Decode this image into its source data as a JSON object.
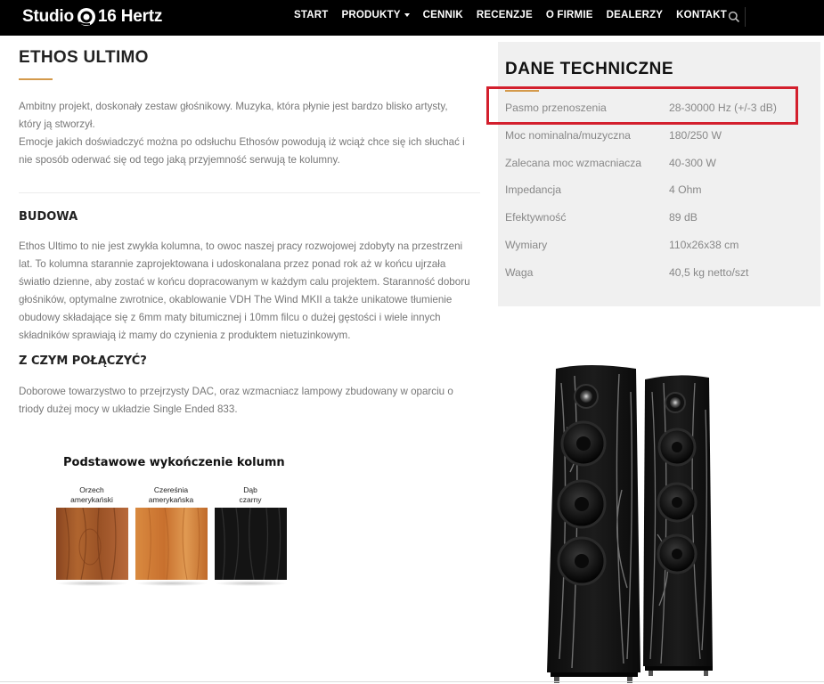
{
  "header": {
    "logo_left": "Studio",
    "logo_right": "16 Hertz",
    "nav": [
      {
        "label": "START"
      },
      {
        "label": "PRODUKTY",
        "has_dropdown": true
      },
      {
        "label": "CENNIK"
      },
      {
        "label": "RECENZJE"
      },
      {
        "label": "O FIRMIE"
      },
      {
        "label": "DEALERZY"
      },
      {
        "label": "KONTAKT"
      }
    ],
    "search_icon": "search-icon"
  },
  "main": {
    "title": "ETHOS ULTIMO",
    "intro": [
      "Ambitny projekt, doskonały zestaw głośnikowy. Muzyka, która płynie jest bardzo blisko artysty,",
      "który ją stworzył.",
      "Emocje jakich doświadczyć można po odsłuchu Ethosów powodują iż wciąż chce się ich słuchać i",
      "nie sposób oderwać się od tego jaką przyjemność serwują te kolumny."
    ],
    "budowa_heading": "BUDOWA",
    "budowa_text": [
      "Ethos Ultimo to nie jest zwykła kolumna, to owoc naszej pracy rozwojowej zdobyty na przestrzeni",
      "lat. To kolumna starannie zaprojektowana i udoskonalana  przez ponad rok aż w końcu ujrzała",
      "światło dzienne, aby zostać w końcu dopracowanym w każdym calu projektem. Staranność doboru",
      "głośników, optymalne zwrotnice, okablowanie VDH The Wind MKII a także unikatowe tłumienie",
      "obudowy składające się z 6mm maty bitumicznej i 10mm filcu o dużej gęstości i wiele innych",
      "składników sprawiają iż mamy do czynienia z produktem nietuzinkowym."
    ],
    "pair_heading": "Z CZYM POŁĄCZYĆ?",
    "pair_text": [
      "Doborowe towarzystwo to przejrzysty DAC, oraz wzmacniacz lampowy zbudowany w oparciu o",
      "triody dużej mocy w układzie Single Ended 833."
    ],
    "finish": {
      "title": "Podstawowe wykończenie kolumn",
      "options": [
        {
          "label_l1": "Orzech",
          "label_l2": "amerykański",
          "color": "#a0522d"
        },
        {
          "label_l1": "Czereśnia",
          "label_l2": "amerykańska",
          "color": "#c8702e"
        },
        {
          "label_l1": "Dąb",
          "label_l2": "czarny",
          "color": "#141414"
        }
      ]
    }
  },
  "tech": {
    "title": "DANE TECHNICZNE",
    "specs": [
      {
        "label": "Pasmo przenoszenia",
        "value": "28-30000 Hz (+/-3 dB)"
      },
      {
        "label": "Moc nominalna/muzyczna",
        "value": "180/250 W"
      },
      {
        "label": "Zalecana moc wzmacniacza",
        "value": "40-300 W"
      },
      {
        "label": "Impedancja",
        "value": "4 Ohm"
      },
      {
        "label": "Efektywność",
        "value": "89 dB"
      },
      {
        "label": "Wymiary",
        "value": "110x26x38 cm"
      },
      {
        "label": "Waga",
        "value": "40,5 kg netto/szt"
      }
    ],
    "highlight_color": "#d31f2d"
  },
  "colors": {
    "accent": "#d49a4b",
    "nav_bg": "#000000",
    "panel_bg": "#f0f0f0"
  }
}
